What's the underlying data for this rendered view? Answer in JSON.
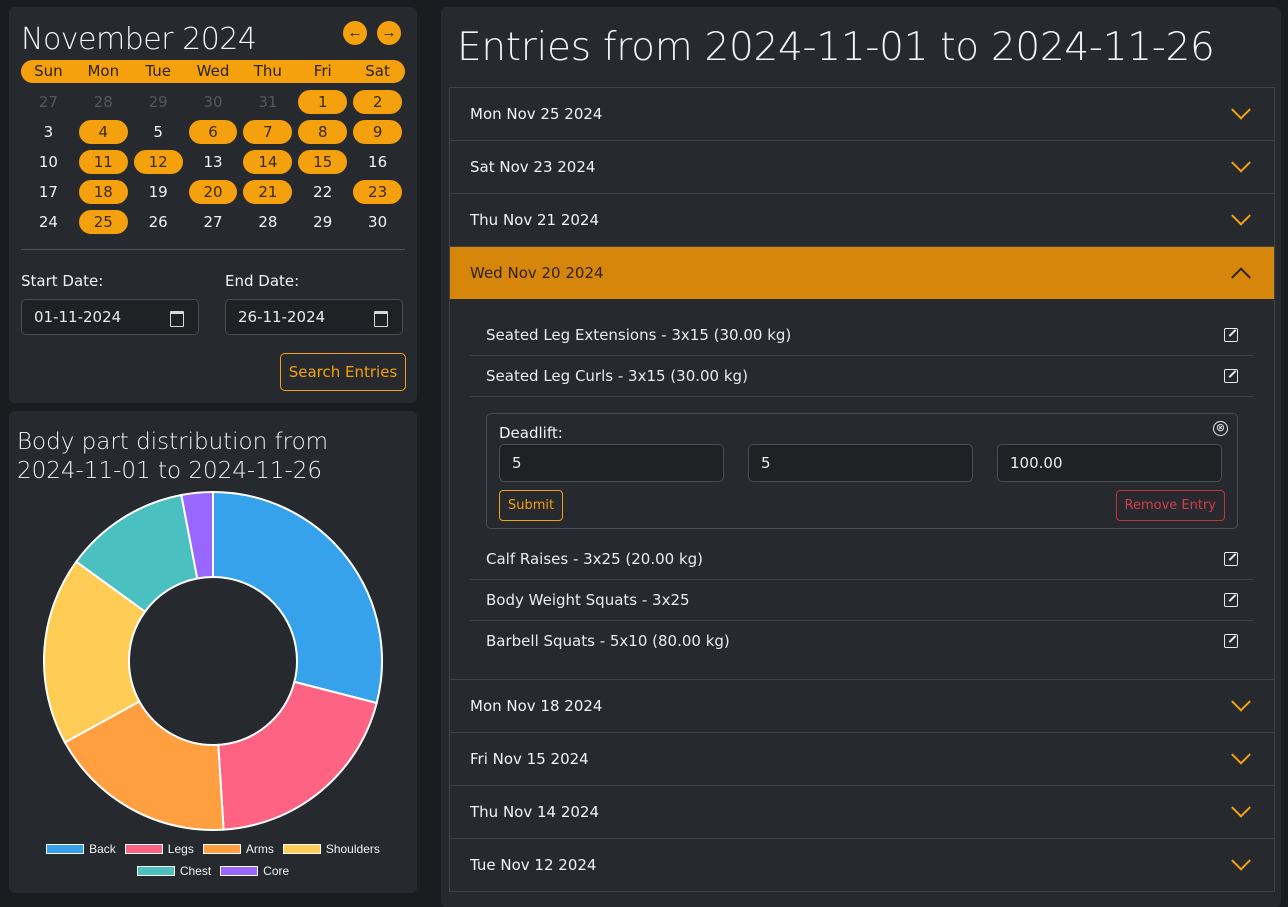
{
  "calendar": {
    "month_title": "November 2024",
    "prev_icon": "arrow-left-icon",
    "next_icon": "arrow-right-icon",
    "prev_glyph": "←",
    "next_glyph": "→",
    "weekdays": [
      "Sun",
      "Mon",
      "Tue",
      "Wed",
      "Thu",
      "Fri",
      "Sat"
    ],
    "weeks": [
      [
        {
          "d": "27",
          "s": "muted"
        },
        {
          "d": "28",
          "s": "muted"
        },
        {
          "d": "29",
          "s": "muted"
        },
        {
          "d": "30",
          "s": "muted"
        },
        {
          "d": "31",
          "s": "muted"
        },
        {
          "d": "1",
          "s": "on"
        },
        {
          "d": "2",
          "s": "on"
        }
      ],
      [
        {
          "d": "3",
          "s": ""
        },
        {
          "d": "4",
          "s": "on"
        },
        {
          "d": "5",
          "s": ""
        },
        {
          "d": "6",
          "s": "on"
        },
        {
          "d": "7",
          "s": "on"
        },
        {
          "d": "8",
          "s": "on"
        },
        {
          "d": "9",
          "s": "on"
        }
      ],
      [
        {
          "d": "10",
          "s": ""
        },
        {
          "d": "11",
          "s": "on"
        },
        {
          "d": "12",
          "s": "on"
        },
        {
          "d": "13",
          "s": ""
        },
        {
          "d": "14",
          "s": "on"
        },
        {
          "d": "15",
          "s": "on"
        },
        {
          "d": "16",
          "s": ""
        }
      ],
      [
        {
          "d": "17",
          "s": ""
        },
        {
          "d": "18",
          "s": "on"
        },
        {
          "d": "19",
          "s": ""
        },
        {
          "d": "20",
          "s": "on"
        },
        {
          "d": "21",
          "s": "on"
        },
        {
          "d": "22",
          "s": ""
        },
        {
          "d": "23",
          "s": "on"
        }
      ],
      [
        {
          "d": "24",
          "s": ""
        },
        {
          "d": "25",
          "s": "on"
        },
        {
          "d": "26",
          "s": ""
        },
        {
          "d": "27",
          "s": ""
        },
        {
          "d": "28",
          "s": ""
        },
        {
          "d": "29",
          "s": ""
        },
        {
          "d": "30",
          "s": ""
        }
      ]
    ],
    "accent_color": "#f5a00d"
  },
  "filters": {
    "start_label": "Start Date:",
    "start_value": "01-11-2024",
    "end_label": "End Date:",
    "end_value": "26-11-2024",
    "search_label": "Search Entries"
  },
  "chart": {
    "title": "Body part distribution from 2024-11-01 to 2024-11-26"
  },
  "chart_data": {
    "type": "pie",
    "donut": true,
    "categories": [
      "Back",
      "Legs",
      "Arms",
      "Shoulders",
      "Chest",
      "Core"
    ],
    "values": [
      29,
      20,
      18,
      18,
      12,
      3
    ],
    "colors": [
      "#36a2eb",
      "#ff6384",
      "#ff9f40",
      "#ffcd56",
      "#4bc0c0",
      "#9966ff"
    ],
    "legend_position": "bottom"
  },
  "entries": {
    "title": "Entries from 2024-11-01 to 2024-11-26",
    "days": [
      {
        "label": "Mon Nov 25 2024"
      },
      {
        "label": "Sat Nov 23 2024"
      },
      {
        "label": "Thu Nov 21 2024"
      },
      {
        "label": "Wed Nov 20 2024"
      },
      {
        "label": "Mon Nov 18 2024"
      },
      {
        "label": "Fri Nov 15 2024"
      },
      {
        "label": "Thu Nov 14 2024"
      },
      {
        "label": "Tue Nov 12 2024"
      }
    ],
    "open_day": {
      "exercises_before": [
        "Seated Leg Extensions - 3x15 (30.00 kg)",
        "Seated Leg Curls - 3x15 (30.00 kg)"
      ],
      "edit_form": {
        "label": "Deadlift:",
        "sets": "5",
        "reps": "5",
        "weight": "100.00",
        "submit_label": "Submit",
        "remove_label": "Remove Entry",
        "close_glyph": "⊗"
      },
      "exercises_after": [
        "Calf Raises - 3x25 (20.00 kg)",
        "Body Weight Squats - 3x25",
        "Barbell Squats - 5x10 (80.00 kg)"
      ]
    }
  }
}
